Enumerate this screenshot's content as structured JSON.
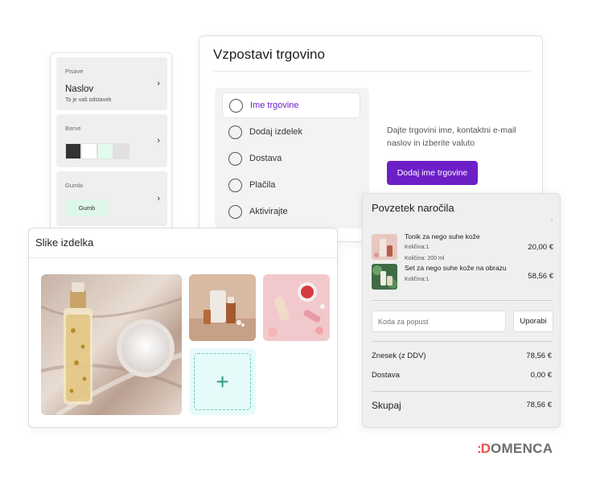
{
  "styles_panel": {
    "fonts": {
      "caption": "Pisave",
      "heading": "Naslov",
      "subtext": "To je vaš odstavek"
    },
    "colors": {
      "caption": "Barve",
      "swatches": [
        "#333333",
        "#ffffff",
        "#e3fbef",
        "#e0e0e0"
      ]
    },
    "buttons": {
      "caption": "Gumbi",
      "sample_label": "Gumb"
    }
  },
  "store_setup": {
    "title": "Vzpostavi trgovino",
    "steps": [
      {
        "label": "Ime trgovine",
        "active": true
      },
      {
        "label": "Dodaj izdelek",
        "active": false
      },
      {
        "label": "Dostava",
        "active": false
      },
      {
        "label": "Plačila",
        "active": false
      },
      {
        "label": "Aktivirajte",
        "active": false
      }
    ],
    "description": "Dajte trgovini ime, kontaktni e-mail naslov in izberite valuto",
    "primary_button": "Dodaj ime trgovine"
  },
  "product_images": {
    "title": "Slike izdelka",
    "add_symbol": "+"
  },
  "order_summary": {
    "title": "Povzetek naročila",
    "items": [
      {
        "name": "Tonik za nego suhe kože",
        "quantity": "Količina:1",
        "size": "Količina: 200 ml",
        "price": "20,00 €"
      },
      {
        "name": "Set za nego suhe kože na obrazu",
        "quantity": "Količina:1",
        "price": "58,56 €"
      }
    ],
    "coupon": {
      "placeholder": "Koda za popust",
      "apply_label": "Uporabi"
    },
    "rows": [
      {
        "label": "Znesek (z DDV)",
        "value": "78,56 €"
      },
      {
        "label": "Dostava",
        "value": "0,00 €"
      }
    ],
    "total": {
      "label": "Skupaj",
      "value": "78,56 €"
    }
  },
  "brand": {
    "mark": ":D",
    "name": "OMENCA",
    "accent": "#6d1fc7"
  }
}
